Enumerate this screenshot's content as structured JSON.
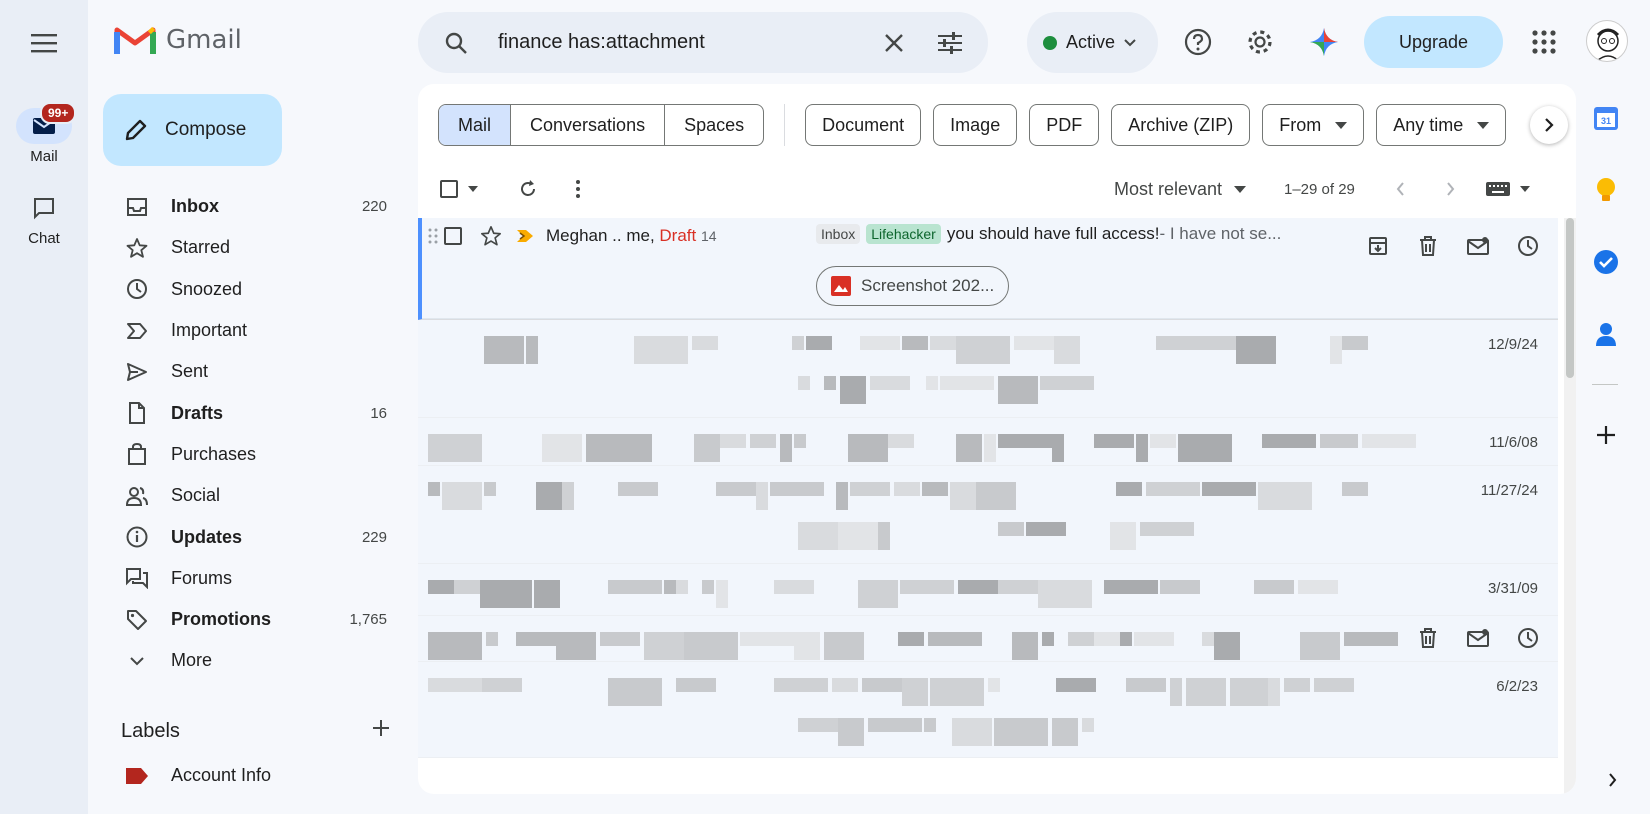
{
  "rail": {
    "items": [
      {
        "label": "Mail",
        "badge": "99+"
      },
      {
        "label": "Chat"
      }
    ]
  },
  "logo": {
    "text": "Gmail"
  },
  "compose": {
    "label": "Compose"
  },
  "nav": [
    {
      "label": "Inbox",
      "count": "220",
      "icon": "inbox-icon",
      "bold": true
    },
    {
      "label": "Starred",
      "count": "",
      "icon": "star-icon",
      "bold": false
    },
    {
      "label": "Snoozed",
      "count": "",
      "icon": "clock-icon",
      "bold": false
    },
    {
      "label": "Important",
      "count": "",
      "icon": "important-icon",
      "bold": false
    },
    {
      "label": "Sent",
      "count": "",
      "icon": "send-icon",
      "bold": false
    },
    {
      "label": "Drafts",
      "count": "16",
      "icon": "draft-icon",
      "bold": true
    },
    {
      "label": "Purchases",
      "count": "",
      "icon": "shopping-bag-icon",
      "bold": false
    },
    {
      "label": "Social",
      "count": "",
      "icon": "people-icon",
      "bold": false
    },
    {
      "label": "Updates",
      "count": "229",
      "icon": "info-icon",
      "bold": true
    },
    {
      "label": "Forums",
      "count": "",
      "icon": "forum-icon",
      "bold": false
    },
    {
      "label": "Promotions",
      "count": "1,765",
      "icon": "tag-icon",
      "bold": true
    },
    {
      "label": "More",
      "count": "",
      "icon": "chevron-down-icon",
      "bold": false
    }
  ],
  "labels": {
    "heading": "Labels",
    "items": [
      {
        "label": "Account Info",
        "color": "#b3261e"
      }
    ]
  },
  "search": {
    "query": "finance has:attachment"
  },
  "status": {
    "label": "Active",
    "color": "#1e8e3e"
  },
  "upgrade": {
    "label": "Upgrade"
  },
  "tabs": {
    "segments": [
      "Mail",
      "Conversations",
      "Spaces"
    ],
    "selected": "Mail"
  },
  "filters": [
    "Document",
    "Image",
    "PDF",
    "Archive (ZIP)",
    "From",
    "Any time"
  ],
  "filter_dropdowns": [
    "From",
    "Any time"
  ],
  "toolbar": {
    "sort": "Most relevant",
    "range": "1–29 of 29"
  },
  "selected_email": {
    "sender": "Meghan .. me,",
    "draft": "Draft",
    "count": "14",
    "tags": [
      {
        "label": "Inbox",
        "bg": "#e8eaed"
      },
      {
        "label": "Lifehacker",
        "bg": "#b9e4d0"
      }
    ],
    "subject": "you should have full access!",
    "snippet": " - I have not se...",
    "attachment": "Screenshot 202..."
  },
  "blurred_rows": [
    {
      "date": "12/9/24"
    },
    {
      "date": "11/6/08"
    },
    {
      "date": "11/27/24"
    },
    {
      "date": "3/31/09"
    },
    {
      "date": ""
    },
    {
      "date": "6/2/23"
    }
  ],
  "colors": {
    "accent": "#0b57d0",
    "draft": "#d93025",
    "important": "#f9ab00"
  }
}
